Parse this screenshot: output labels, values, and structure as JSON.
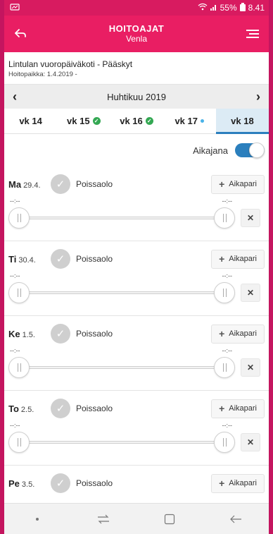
{
  "statusbar": {
    "signal_label": "55%",
    "time": "8.41"
  },
  "appbar": {
    "title": "HOITOAJAT",
    "subtitle": "Venla"
  },
  "info": {
    "name": "Lintulan vuoropäiväkoti - Pääskyt",
    "place": "Hoitopaikka: 1.4.2019 -"
  },
  "monthnav": {
    "month": "Huhtikuu 2019"
  },
  "weeks": [
    {
      "label": "vk 14",
      "status": ""
    },
    {
      "label": "vk 15",
      "status": "done"
    },
    {
      "label": "vk 16",
      "status": "done"
    },
    {
      "label": "vk 17",
      "status": "dot"
    },
    {
      "label": "vk 18",
      "status": "active"
    }
  ],
  "timeline": {
    "label": "Aikajana",
    "enabled": true
  },
  "days": [
    {
      "day": "Ma",
      "date": "29.4.",
      "absence": "Poissaolo",
      "start": "--:--",
      "end": "--:--",
      "add_label": "Aikapari"
    },
    {
      "day": "Ti",
      "date": "30.4.",
      "absence": "Poissaolo",
      "start": "--:--",
      "end": "--:--",
      "add_label": "Aikapari"
    },
    {
      "day": "Ke",
      "date": "1.5.",
      "absence": "Poissaolo",
      "start": "--:--",
      "end": "--:--",
      "add_label": "Aikapari"
    },
    {
      "day": "To",
      "date": "2.5.",
      "absence": "Poissaolo",
      "start": "--:--",
      "end": "--:--",
      "add_label": "Aikapari"
    },
    {
      "day": "Pe",
      "date": "3.5.",
      "absence": "Poissaolo",
      "add_label": "Aikapari"
    }
  ],
  "colors": {
    "accent": "#e91e63",
    "status_bar": "#d81b60",
    "active_tab": "#2b7fbd",
    "done": "#34a853"
  }
}
